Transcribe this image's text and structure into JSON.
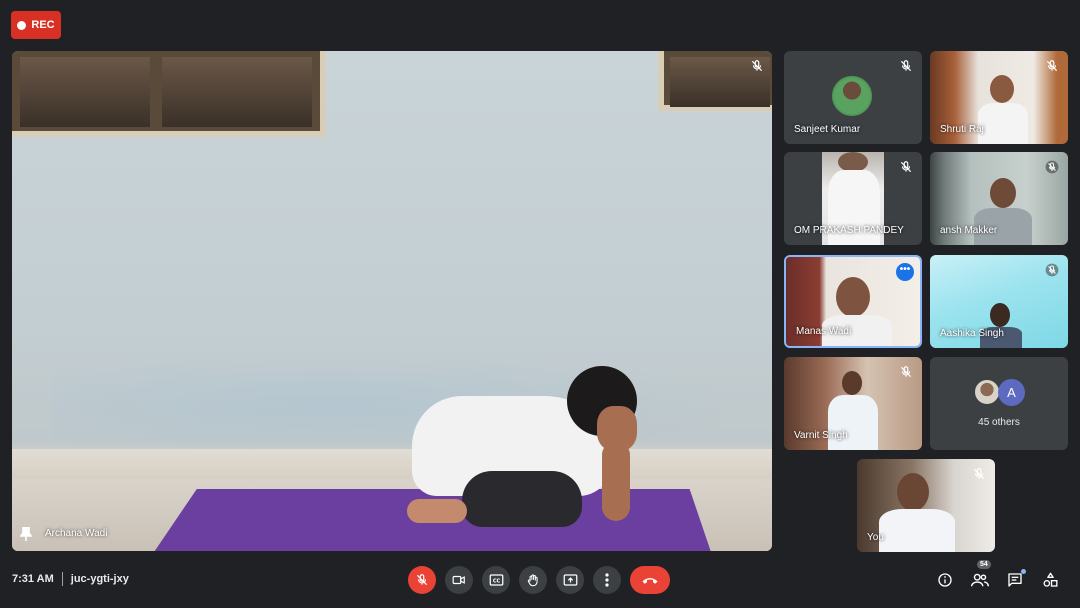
{
  "recording": {
    "label": "REC"
  },
  "stage": {
    "name": "Archana Wadi"
  },
  "participants": [
    {
      "name": "Sanjeet Kumar"
    },
    {
      "name": "Shruti Raj"
    },
    {
      "name": "OM PRAKASH PANDEY"
    },
    {
      "name": "ansh Makker"
    },
    {
      "name": "Manas Wadi"
    },
    {
      "name": "Aashika Singh"
    },
    {
      "name": "Varnit Singh"
    },
    {
      "name": "You"
    }
  ],
  "others": {
    "avatar_letter": "A",
    "label": "45 others"
  },
  "meeting": {
    "time": "7:31 AM",
    "code": "juc-ygti-jxy"
  },
  "people_count": "54",
  "colors": {
    "end_call": "#ea4335",
    "active_border": "#8ab4f8",
    "rec": "#d93025"
  }
}
